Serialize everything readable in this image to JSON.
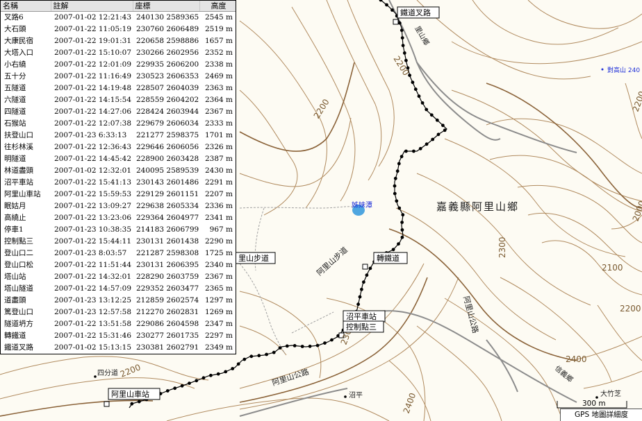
{
  "waypoint_table": {
    "headers": {
      "name": "名稱",
      "note": "註解",
      "coord": "座標",
      "alt": "高度"
    },
    "rows": [
      {
        "name": "叉路6",
        "time": "2007-01-02 12:21:43",
        "coord": "240130 2589365",
        "alt": "2545 m"
      },
      {
        "name": "大石頭",
        "time": "2007-01-22 11:05:19",
        "coord": "230760 2606489",
        "alt": "2519 m"
      },
      {
        "name": "大康民宿",
        "time": "2007-01-22 19:01:31",
        "coord": "220658 2598886",
        "alt": "1657 m"
      },
      {
        "name": "大塔入口",
        "time": "2007-01-22 15:10:07",
        "coord": "230266 2602956",
        "alt": "2352 m"
      },
      {
        "name": "小右繞",
        "time": "2007-01-22 12:01:09",
        "coord": "229935 2606200",
        "alt": "2338 m"
      },
      {
        "name": "五十分",
        "time": "2007-01-22 11:16:49",
        "coord": "230523 2606353",
        "alt": "2469 m"
      },
      {
        "name": "五隧道",
        "time": "2007-01-22 14:19:48",
        "coord": "228507 2604039",
        "alt": "2363 m"
      },
      {
        "name": "六隧道",
        "time": "2007-01-22 14:15:54",
        "coord": "228559 2604202",
        "alt": "2364 m"
      },
      {
        "name": "四隧道",
        "time": "2007-01-22 14:27:06",
        "coord": "228424 2603944",
        "alt": "2367 m"
      },
      {
        "name": "石猴站",
        "time": "2007-01-22 12:07:38",
        "coord": "229679 2606034",
        "alt": "2333 m"
      },
      {
        "name": "扶登山口",
        "time": "2007-01-23 6:33:13",
        "coord": "221277 2598375",
        "alt": "1701 m"
      },
      {
        "name": "往杉林溪",
        "time": "2007-01-22 12:36:43",
        "coord": "229646 2606056",
        "alt": "2326 m"
      },
      {
        "name": "明隧道",
        "time": "2007-01-22 14:45:42",
        "coord": "228900 2603428",
        "alt": "2387 m"
      },
      {
        "name": "林道盡頭",
        "time": "2007-01-02 12:32:01",
        "coord": "240095 2589539",
        "alt": "2430 m"
      },
      {
        "name": "沼平車站",
        "time": "2007-01-22 15:41:13",
        "coord": "230143 2601486",
        "alt": "2291 m"
      },
      {
        "name": "阿里山車站",
        "time": "2007-01-22 15:59:53",
        "coord": "229129 2601151",
        "alt": "2207 m"
      },
      {
        "name": "眠姑月",
        "time": "2007-01-22 13:09:27",
        "coord": "229638 2605334",
        "alt": "2336 m"
      },
      {
        "name": "高繞止",
        "time": "2007-01-22 13:23:06",
        "coord": "229364 2604977",
        "alt": "2341 m"
      },
      {
        "name": "停車1",
        "time": "2007-01-23 10:38:35",
        "coord": "214183 2606799",
        "alt": "967 m"
      },
      {
        "name": "控制點三",
        "time": "2007-01-22 15:44:11",
        "coord": "230131 2601438",
        "alt": "2290 m"
      },
      {
        "name": "登山口二",
        "time": "2007-01-23 8:03:57",
        "coord": "221287 2598308",
        "alt": "1725 m"
      },
      {
        "name": "登山口松",
        "time": "2007-01-22 11:51:44",
        "coord": "230131 2606395",
        "alt": "2340 m"
      },
      {
        "name": "塔山站",
        "time": "2007-01-22 14:32:01",
        "coord": "228290 2603759",
        "alt": "2367 m"
      },
      {
        "name": "塔山隧道",
        "time": "2007-01-22 14:57:09",
        "coord": "229352 2603477",
        "alt": "2365 m"
      },
      {
        "name": "道盡頭",
        "time": "2007-01-23 13:12:25",
        "coord": "212859 2602574",
        "alt": "1297 m"
      },
      {
        "name": "篤登山口",
        "time": "2007-01-23 12:57:58",
        "coord": "212270 2602831",
        "alt": "1269 m"
      },
      {
        "name": "隧道坍方",
        "time": "2007-01-22 13:51:58",
        "coord": "229086 2604598",
        "alt": "2347 m"
      },
      {
        "name": "轉鐵道",
        "time": "2007-01-22 15:31:46",
        "coord": "230277 2601735",
        "alt": "2297 m"
      },
      {
        "name": "鐵道叉路",
        "time": "2007-01-02 15:13:15",
        "coord": "230381 2602791",
        "alt": "2349 m"
      }
    ]
  },
  "map": {
    "waypoint_labels": {
      "tiedao_chalu": "鐵道叉路",
      "zhuan_tiedao": "轉鐵道",
      "zhaoping_station": "沼平車站",
      "control_point3": "控制點三",
      "alishan_station": "阿里山車站",
      "alishan_trail_boxed": "里山步道"
    },
    "place_labels": {
      "township": "嘉義縣阿里山鄉",
      "pond": "姊妹潭",
      "trail": "阿里山步道",
      "road1": "阿里山公路",
      "road2": "阿里山公路",
      "sidao": "四分道",
      "zhaoping": "沼平",
      "rail": "鐵道",
      "dazhuzhi": "大竹芝",
      "xinyi": "信義鄉",
      "mt_top": "對高山 240",
      "rail_vertical": "里山鄉"
    },
    "contour_labels": {
      "c2200_top": "2200",
      "c2200_mid": "2200",
      "c2300": "2300",
      "c2100": "2100",
      "c2200_right": "2200",
      "c2400": "2400",
      "c2200_bottom": "2200",
      "c2400_bottom": "2400",
      "c2300_bottom": "2300",
      "c2000": "2000",
      "c2200_rail": "2200"
    },
    "colors": {
      "contour": "#b08a5e",
      "contour_index": "#8a6238",
      "track": "#000000",
      "road": "#8c8c8c",
      "trail": "#a0a0a0",
      "water": "#4fa6e0",
      "label_blue": "#1f2fd8"
    }
  },
  "scale_bar": {
    "distance": "300 m",
    "caption": "GPS 地圖詳細度"
  }
}
